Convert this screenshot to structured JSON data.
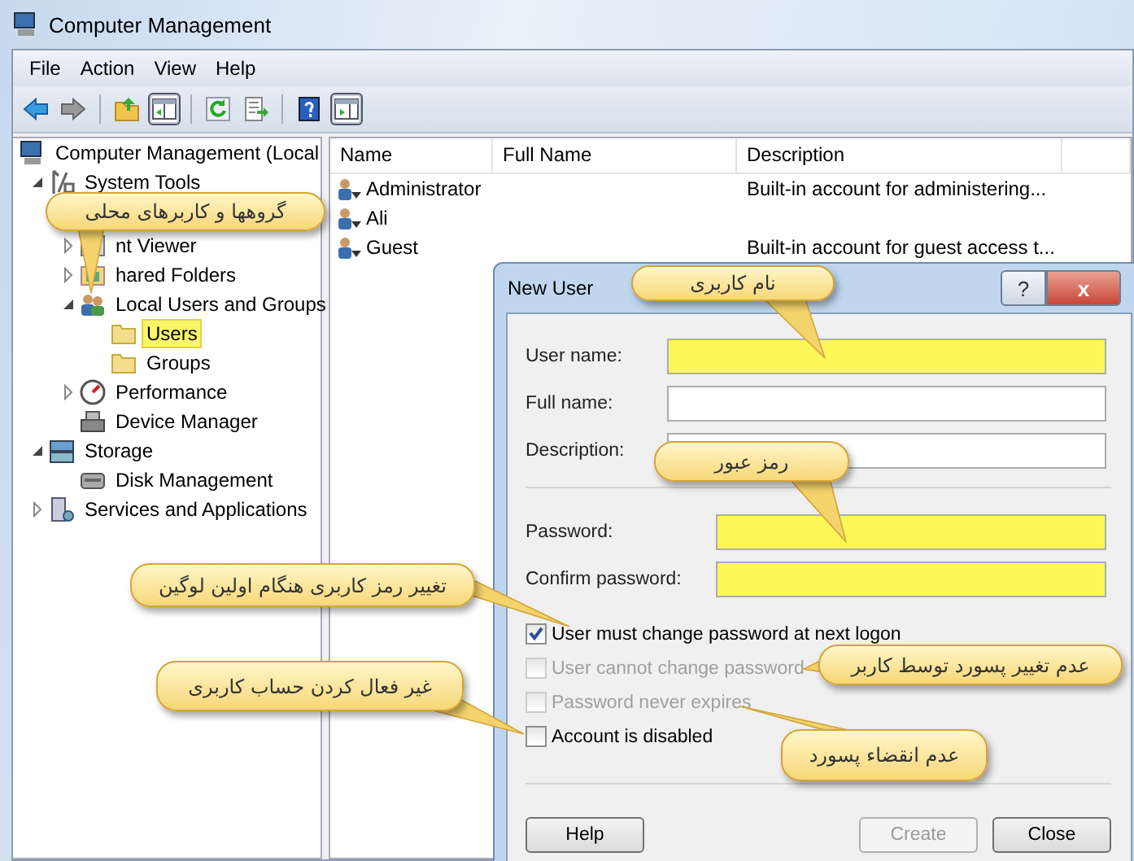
{
  "window": {
    "title": "Computer Management"
  },
  "menu": [
    "File",
    "Action",
    "View",
    "Help"
  ],
  "toolbar": [
    {
      "kind": "back",
      "pressed": false
    },
    {
      "kind": "forward",
      "pressed": false
    },
    {
      "kind": "sep"
    },
    {
      "kind": "up",
      "pressed": false
    },
    {
      "kind": "tree",
      "pressed": true
    },
    {
      "kind": "sep"
    },
    {
      "kind": "refresh",
      "pressed": false
    },
    {
      "kind": "export",
      "pressed": false
    },
    {
      "kind": "sep"
    },
    {
      "kind": "help",
      "pressed": false
    },
    {
      "kind": "pane",
      "pressed": true
    }
  ],
  "tree": [
    {
      "label": "Computer Management (Local",
      "kind": "computer",
      "selected": false,
      "children": [
        {
          "label": "System Tools",
          "kind": "tools",
          "expanded": true,
          "selected": false,
          "children": [
            {
              "label": "nt Viewer",
              "kind": "viewer",
              "expanded": false,
              "selected": false
            },
            {
              "label": "hared Folders",
              "kind": "share",
              "expanded": false,
              "selected": false
            },
            {
              "label": "Local Users and Groups",
              "kind": "users",
              "expanded": true,
              "selected": false,
              "children": [
                {
                  "label": "Users",
                  "kind": "folder",
                  "selected": true
                },
                {
                  "label": "Groups",
                  "kind": "folder",
                  "selected": false
                }
              ]
            },
            {
              "label": "Performance",
              "kind": "performance",
              "expanded": false,
              "selected": false
            },
            {
              "label": "Device Manager",
              "kind": "device",
              "selected": false
            }
          ]
        },
        {
          "label": "Storage",
          "kind": "storage",
          "expanded": true,
          "selected": false,
          "children": [
            {
              "label": "Disk Management",
              "kind": "disk",
              "selected": false
            }
          ]
        },
        {
          "label": "Services and Applications",
          "kind": "services",
          "expanded": false,
          "selected": false
        }
      ]
    }
  ],
  "table": {
    "columns": [
      "Name",
      "Full Name",
      "Description"
    ],
    "rows": [
      {
        "name": "Administrator",
        "full_name": "",
        "description": "Built-in account for administering..."
      },
      {
        "name": "Ali",
        "full_name": "",
        "description": ""
      },
      {
        "name": "Guest",
        "full_name": "",
        "description": "Built-in account for guest access t..."
      }
    ]
  },
  "dialog": {
    "title": "New User",
    "help_button": "?",
    "close_button": "x",
    "fields": [
      {
        "label": "User name:",
        "highlighted": true
      },
      {
        "label": "Full name:",
        "highlighted": false
      },
      {
        "label": "Description:",
        "highlighted": false
      },
      {
        "label": "Password:",
        "highlighted": true
      },
      {
        "label": "Confirm password:",
        "highlighted": true
      }
    ],
    "checkboxes": [
      {
        "label": "User must change password at next logon",
        "checked": true,
        "disabled": false
      },
      {
        "label": "User cannot change password",
        "checked": false,
        "disabled": true
      },
      {
        "label": "Password never expires",
        "checked": false,
        "disabled": true
      },
      {
        "label": "Account is disabled",
        "checked": false,
        "disabled": false
      }
    ],
    "buttons": [
      {
        "label": "Help",
        "disabled": false
      },
      {
        "label": "Create",
        "disabled": true
      },
      {
        "label": "Close",
        "disabled": false
      }
    ]
  },
  "callouts": [
    "گروهها و کاربرهای محلی",
    "نام کاربری",
    "رمز عبور",
    "تغییر رمز کاربری هنگام اولین لوگین",
    "غیر فعال کردن حساب کاربری",
    "عدم تغییر پسورد توسط کاربر",
    "عدم انقضاء پسورد"
  ]
}
